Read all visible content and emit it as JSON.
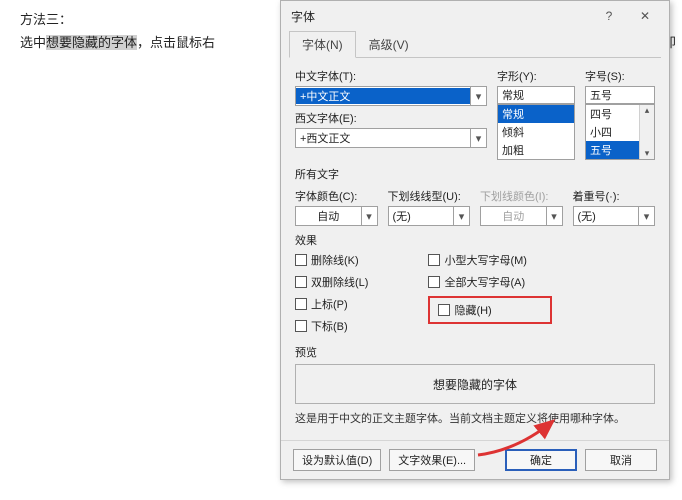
{
  "doc": {
    "line1": "方法三：",
    "line2_pre": "选中",
    "line2_sel": "想要隐藏的字体",
    "line2_post": "，点击鼠标右",
    "tail": "能即"
  },
  "dialog": {
    "title": "字体",
    "tabs": {
      "font": "字体(N)",
      "advanced": "高级(V)"
    },
    "fontCN": {
      "label": "中文字体(T):",
      "value": "+中文正文"
    },
    "fontEN": {
      "label": "西文字体(E):",
      "value": "+西文正文"
    },
    "style": {
      "label": "字形(Y):",
      "value": "常规",
      "opts": [
        "常规",
        "倾斜",
        "加粗"
      ]
    },
    "size": {
      "label": "字号(S):",
      "value": "五号",
      "opts": [
        "四号",
        "小四",
        "五号"
      ]
    },
    "allText": "所有文字",
    "fontColor": {
      "label": "字体颜色(C):",
      "value": "自动"
    },
    "underline": {
      "label": "下划线线型(U):",
      "value": "(无)"
    },
    "ulColor": {
      "label": "下划线颜色(I):",
      "value": "自动"
    },
    "emphasis": {
      "label": "着重号(·):",
      "value": "(无)"
    },
    "effectsH": "效果",
    "effects": {
      "strike": "删除线(K)",
      "dstrike": "双删除线(L)",
      "super": "上标(P)",
      "sub": "下标(B)",
      "smallcap": "小型大写字母(M)",
      "allcap": "全部大写字母(A)",
      "hidden": "隐藏(H)"
    },
    "previewH": "预览",
    "previewText": "想要隐藏的字体",
    "note": "这是用于中文的正文主题字体。当前文档主题定义将使用哪种字体。",
    "buttons": {
      "defaults": "设为默认值(D)",
      "textfx": "文字效果(E)...",
      "ok": "确定",
      "cancel": "取消"
    }
  }
}
